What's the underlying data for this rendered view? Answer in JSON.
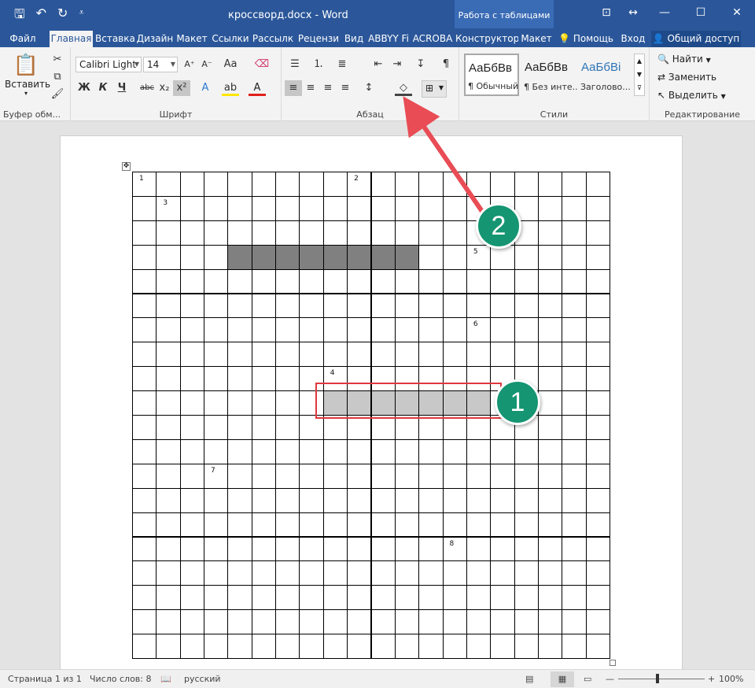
{
  "title_bar": {
    "doc_title": "кроссворд.docx - Word",
    "context_group": "Работа с таблицами",
    "qat": [
      "save-icon",
      "undo-icon",
      "redo-icon",
      "customize-icon"
    ]
  },
  "tabs": [
    "Файл",
    "Главная",
    "Вставка",
    "Дизайн",
    "Макет",
    "Ссылки",
    "Рассылк",
    "Рецензи",
    "Вид",
    "ABBYY Fi",
    "ACROBA",
    "Конструктор",
    "Макет",
    "Помощь",
    "Вход",
    "Общий доступ"
  ],
  "active_tab": "Главная",
  "ribbon": {
    "clipboard": {
      "paste": "Вставить",
      "label": "Буфер обм..."
    },
    "font": {
      "name": "Calibri Light",
      "size": "14",
      "label": "Шрифт",
      "bold": "Ж",
      "italic": "К",
      "underline": "Ч",
      "strike": "abc",
      "sub": "x₂",
      "sup": "x²"
    },
    "paragraph": {
      "label": "Абзац"
    },
    "styles": {
      "label": "Стили",
      "items": [
        {
          "sample": "АаБбВв",
          "name": "¶ Обычный"
        },
        {
          "sample": "АаБбВв",
          "name": "¶ Без инте..."
        },
        {
          "sample": "АаБбВі",
          "name": "Заголово..."
        }
      ]
    },
    "editing": {
      "find": "Найти",
      "replace": "Заменить",
      "select": "Выделить",
      "label": "Редактирование"
    }
  },
  "crossword": {
    "rows": 20,
    "cols": 20,
    "numbers": [
      {
        "row": 0,
        "col": 0,
        "n": "1"
      },
      {
        "row": 0,
        "col": 9,
        "n": "2"
      },
      {
        "row": 1,
        "col": 1,
        "n": "3"
      },
      {
        "row": 3,
        "col": 14,
        "n": "5"
      },
      {
        "row": 6,
        "col": 14,
        "n": "6"
      },
      {
        "row": 8,
        "col": 8,
        "n": "4"
      },
      {
        "row": 12,
        "col": 3,
        "n": "7"
      },
      {
        "row": 15,
        "col": 13,
        "n": "8"
      }
    ],
    "dark_cells": {
      "row": 3,
      "from": 4,
      "to": 11,
      "color": "#808080"
    },
    "light_cells": {
      "row": 9,
      "from": 8,
      "to": 14,
      "color": "#c8c8c8"
    }
  },
  "annotations": {
    "step1": "1",
    "step2": "2"
  },
  "status_bar": {
    "page": "Страница 1 из 1",
    "words": "Число слов: 8",
    "lang": "русский",
    "zoom": "100%"
  }
}
